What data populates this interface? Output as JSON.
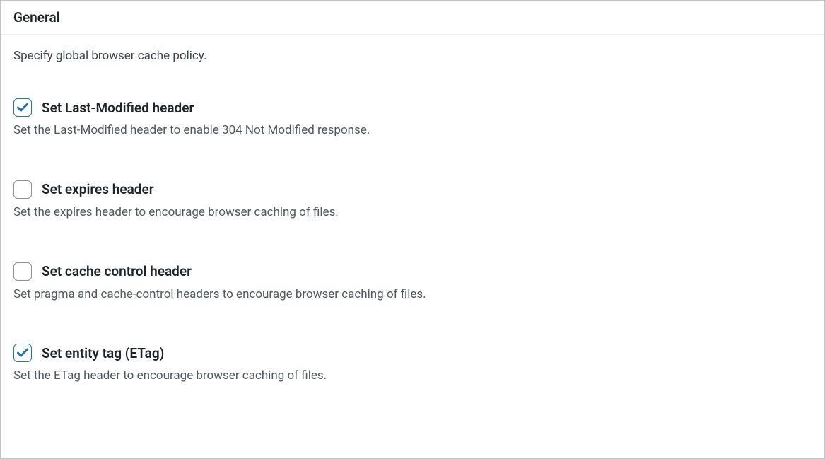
{
  "panel": {
    "title": "General",
    "intro": "Specify global browser cache policy."
  },
  "options": [
    {
      "id": "last-modified",
      "label": "Set Last-Modified header",
      "description": "Set the Last-Modified header to enable 304 Not Modified response.",
      "checked": true
    },
    {
      "id": "expires",
      "label": "Set expires header",
      "description": "Set the expires header to encourage browser caching of files.",
      "checked": false
    },
    {
      "id": "cache-control",
      "label": "Set cache control header",
      "description": "Set pragma and cache-control headers to encourage browser caching of files.",
      "checked": false
    },
    {
      "id": "etag",
      "label": "Set entity tag (ETag)",
      "description": "Set the ETag header to encourage browser caching of files.",
      "checked": true
    }
  ]
}
